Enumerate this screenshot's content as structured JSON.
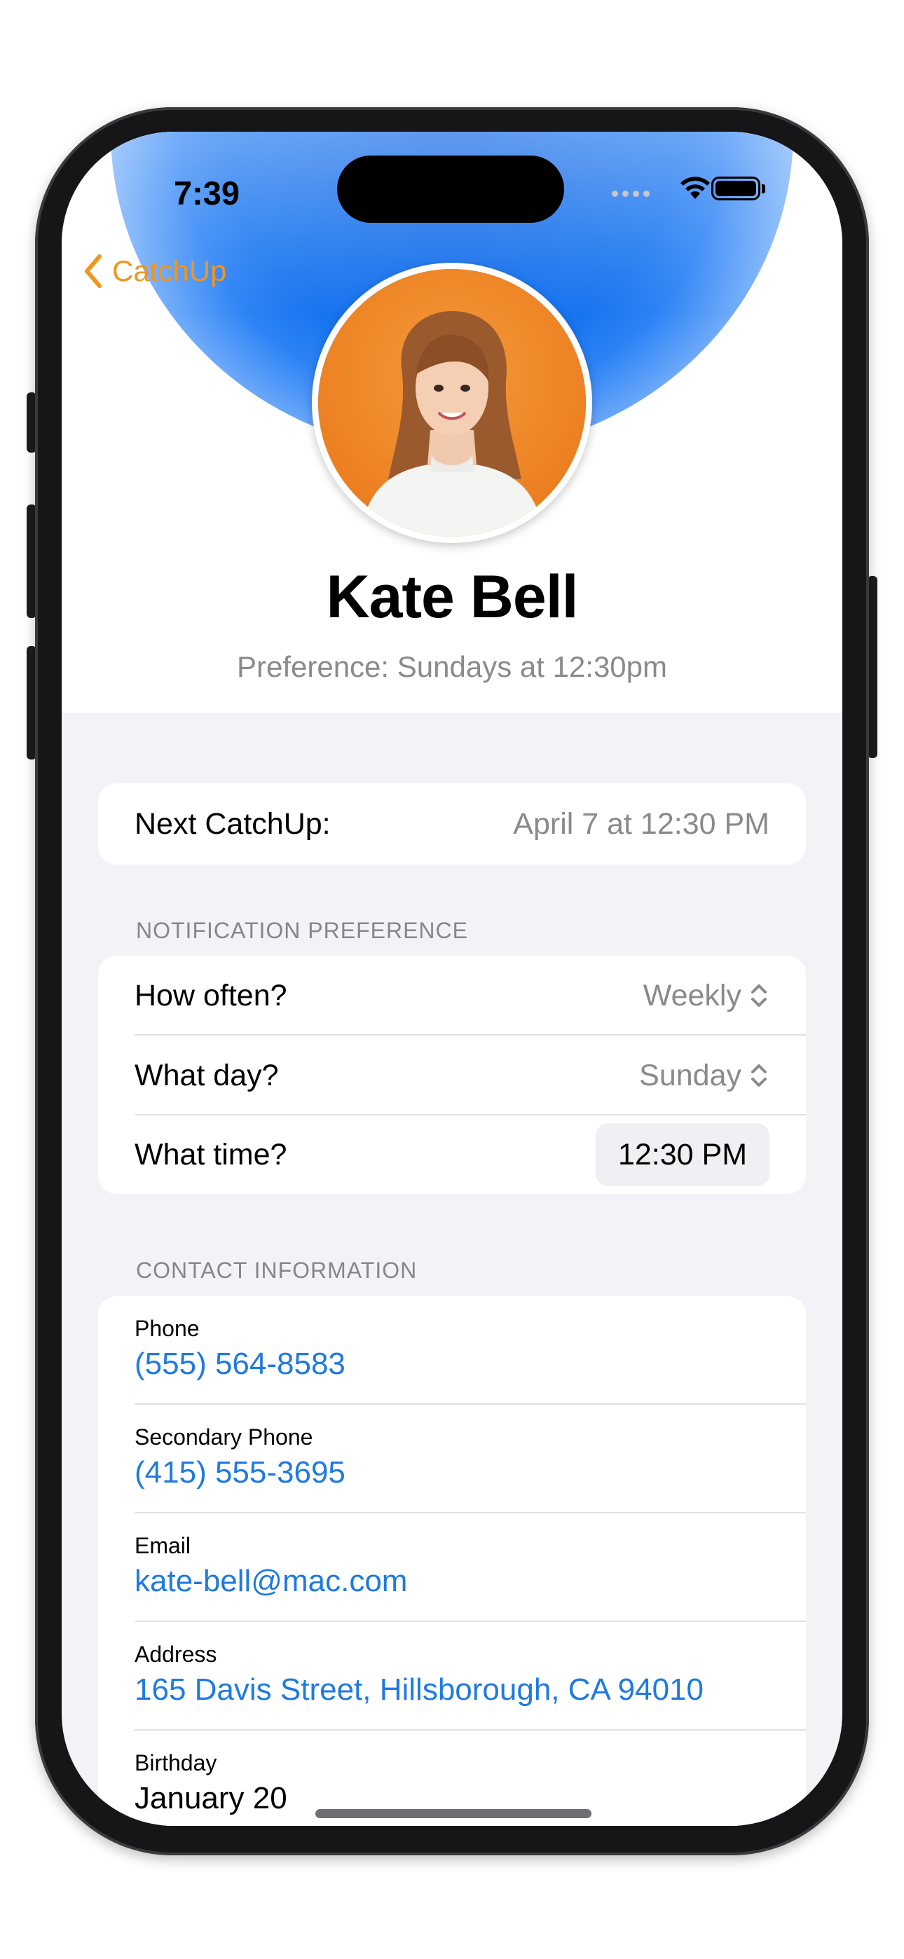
{
  "status_bar": {
    "time": "7:39"
  },
  "nav": {
    "back_label": "CatchUp"
  },
  "profile": {
    "name": "Kate Bell",
    "preference": "Preference: Sundays at 12:30pm",
    "photo_icon": "person-portrait",
    "halo_color": "#1875f0",
    "accent_color": "#f1951b"
  },
  "next_catchup": {
    "label": "Next CatchUp:",
    "value": "April 7 at 12:30 PM"
  },
  "notification": {
    "section_title": "NOTIFICATION PREFERENCE",
    "how_often": {
      "label": "How often?",
      "value": "Weekly"
    },
    "what_day": {
      "label": "What day?",
      "value": "Sunday"
    },
    "what_time": {
      "label": "What time?",
      "value": "12:30 PM"
    }
  },
  "contact": {
    "section_title": "CONTACT INFORMATION",
    "phone": {
      "label": "Phone",
      "value": "(555) 564-8583"
    },
    "secondary_phone": {
      "label": "Secondary Phone",
      "value": "(415) 555-3695"
    },
    "email": {
      "label": "Email",
      "value": "kate-bell@mac.com"
    },
    "address": {
      "label": "Address",
      "value": "165 Davis Street, Hillsborough, CA 94010"
    },
    "birthday": {
      "label": "Birthday",
      "value": "January 20"
    },
    "link_color": "#1f7ae0"
  }
}
